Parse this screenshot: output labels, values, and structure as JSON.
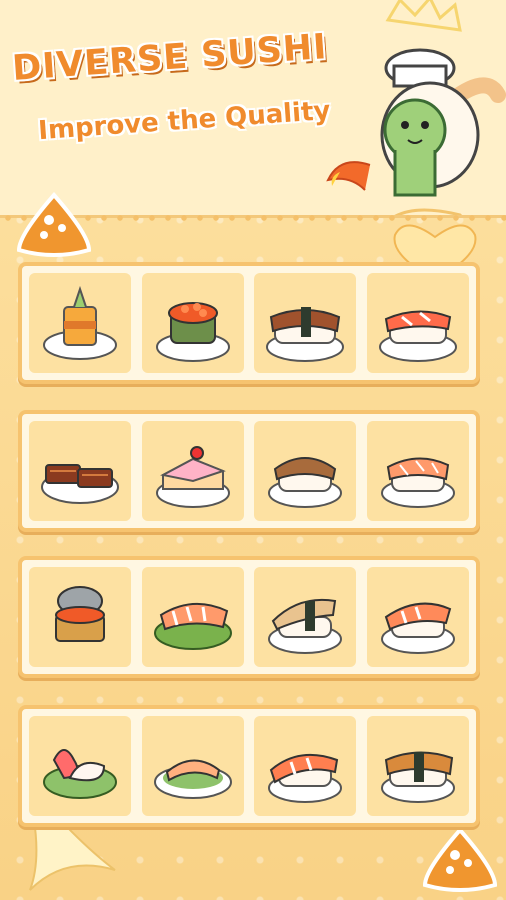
{
  "header": {
    "title": "DIVERSE SUSHI",
    "subtitle": "Improve the Quality"
  },
  "mascot": {
    "icon": "chef-dragon-bunny-icon"
  },
  "colors": {
    "accent": "#f08b2d",
    "frame": "#f6c36f",
    "cell": "#fde1a2",
    "panel": "#fff7e2"
  },
  "rows": [
    {
      "items": [
        {
          "name": "layered-pudding-cup",
          "icon": "layered-dessert-icon"
        },
        {
          "name": "salmon-roe-gunkan",
          "icon": "ikura-gunkan-icon"
        },
        {
          "name": "grilled-eel-nigiri",
          "icon": "unagi-nigiri-icon"
        },
        {
          "name": "crab-stick-nigiri",
          "icon": "kani-nigiri-icon"
        }
      ]
    },
    {
      "items": [
        {
          "name": "grilled-eel-slices",
          "icon": "grilled-eel-icon"
        },
        {
          "name": "strawberry-cake-slice",
          "icon": "cake-slice-icon"
        },
        {
          "name": "seared-nigiri",
          "icon": "seared-nigiri-icon"
        },
        {
          "name": "salmon-nigiri",
          "icon": "salmon-nigiri-icon"
        }
      ]
    },
    {
      "items": [
        {
          "name": "roe-canned-rice",
          "icon": "ikura-can-icon"
        },
        {
          "name": "shrimp-nigiri-plate",
          "icon": "ebi-nigiri-icon"
        },
        {
          "name": "mackerel-nigiri",
          "icon": "saba-nigiri-icon"
        },
        {
          "name": "shrimp-nigiri",
          "icon": "shrimp-nigiri-icon"
        }
      ]
    },
    {
      "items": [
        {
          "name": "clam-sashimi",
          "icon": "clam-icon"
        },
        {
          "name": "salmon-sashimi",
          "icon": "salmon-sashimi-icon"
        },
        {
          "name": "shrimp-nigiri-single",
          "icon": "shrimp-icon"
        },
        {
          "name": "grilled-fish-nigiri",
          "icon": "grilled-fish-icon"
        }
      ]
    }
  ]
}
